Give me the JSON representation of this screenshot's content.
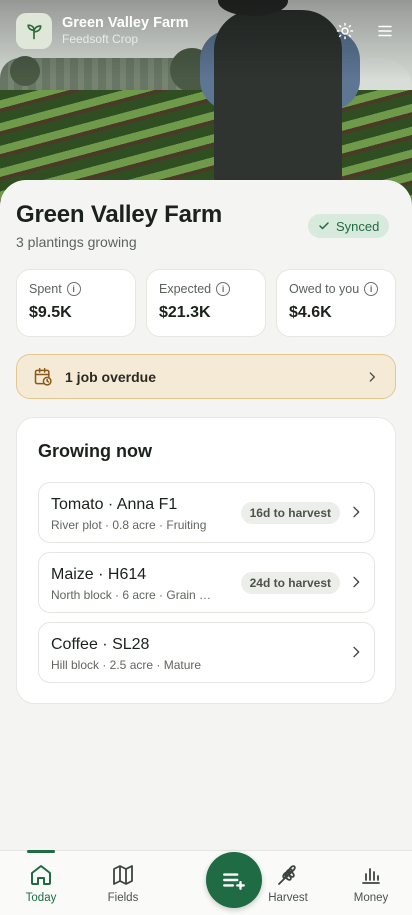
{
  "header": {
    "farm_name": "Green Valley Farm",
    "app_name": "Feedsoft Crop"
  },
  "summary": {
    "title": "Green Valley Farm",
    "subtitle": "3 plantings growing",
    "sync_status": "Synced"
  },
  "stats": [
    {
      "label": "Spent",
      "value": "$9.5K"
    },
    {
      "label": "Expected",
      "value": "$21.3K"
    },
    {
      "label": "Owed to you",
      "value": "$4.6K"
    }
  ],
  "alert": {
    "text": "1 job overdue"
  },
  "growing": {
    "title": "Growing now",
    "crops": [
      {
        "name": "Tomato · Anna F1",
        "meta": "River plot · 0.8 acre · Fruiting",
        "tag": "16d to harvest"
      },
      {
        "name": "Maize · H614",
        "meta": "North block · 6 acre · Grain …",
        "tag": "24d to harvest"
      },
      {
        "name": "Coffee · SL28",
        "meta": "Hill block · 2.5 acre · Mature",
        "tag": ""
      }
    ]
  },
  "nav": {
    "items": [
      {
        "label": "Today",
        "icon": "home-icon",
        "active": true
      },
      {
        "label": "Fields",
        "icon": "map-icon"
      },
      {
        "label": "Harvest",
        "icon": "wheat-icon"
      },
      {
        "label": "Money",
        "icon": "bar-chart-icon"
      }
    ],
    "fab_icon": "add-list-icon"
  },
  "colors": {
    "accent": "#1e6b44",
    "alert_bg": "#f5ead6",
    "badge_bg": "#d8e9dd"
  }
}
